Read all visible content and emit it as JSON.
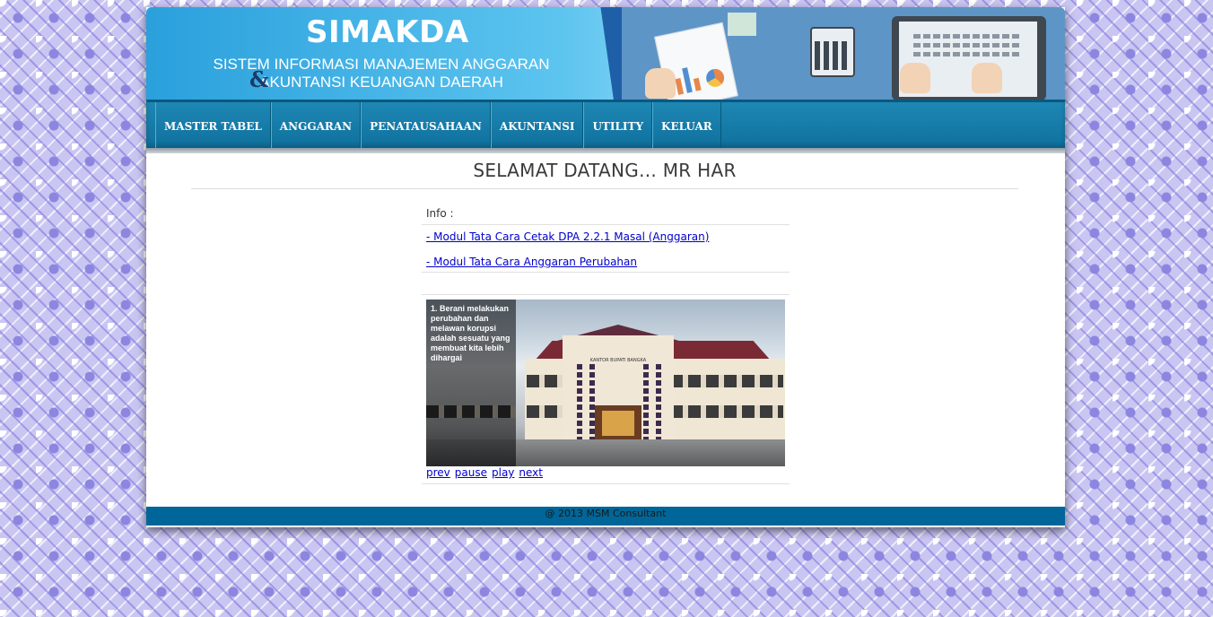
{
  "header": {
    "title": "SIMAKDA",
    "subtitle_line1": "SISTEM INFORMASI MANAJEMEN ANGGARAN",
    "subtitle_line2": "AKUNTANSI KEUANGAN DAERAH",
    "ampersand": "&"
  },
  "nav": {
    "items": [
      {
        "label": "MASTER TABEL"
      },
      {
        "label": "ANGGARAN"
      },
      {
        "label": "PENATAUSAHAAN"
      },
      {
        "label": "AKUNTANSI"
      },
      {
        "label": "UTILITY"
      },
      {
        "label": "KELUAR"
      }
    ]
  },
  "main": {
    "welcome": "SELAMAT DATANG... MR HAR",
    "info_label": "Info :",
    "links": [
      {
        "text": "- Modul Tata Cara Cetak DPA 2.2.1 Masal (Anggaran)"
      },
      {
        "text": "- Modul Tata Cara Anggaran Perubahan"
      }
    ],
    "slideshow": {
      "caption": "1. Berani melakukan perubahan dan melawan korupsi adalah sesuatu yang membuat kita lebih dihargai",
      "building_sign": "KANTOR BUPATI BANGKA",
      "controls": {
        "prev": "prev",
        "pause": "pause",
        "play": "play",
        "next": "next"
      }
    }
  },
  "footer": {
    "text": "@ 2013 MSM Consultant"
  }
}
